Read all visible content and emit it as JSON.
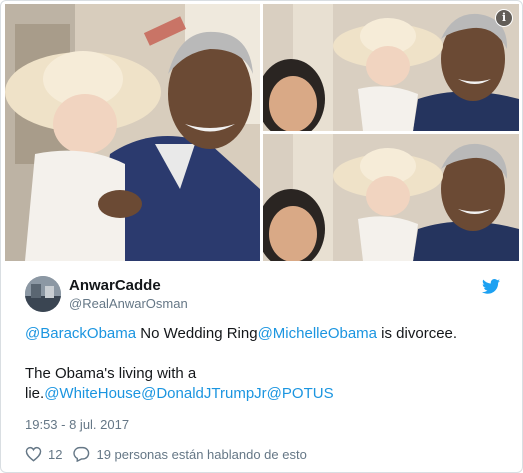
{
  "tweet": {
    "display_name": "AnwarCadde",
    "handle": "@RealAnwarOsman",
    "line1": {
      "mention1": "@BarackObama",
      "text1": " No Wedding Ring",
      "mention2": "@MichelleObama",
      "text2": " is divorcee."
    },
    "line2": "The Obama's living with a",
    "line3": {
      "text1": "lie.",
      "mention1": "@WhiteHouse",
      "mention2": "@DonaldJTrumpJr",
      "mention3": "@POTUS"
    },
    "timestamp": "19:53 - 8 jul. 2017",
    "likes": "12",
    "discussion": "19 personas están hablando de esto"
  },
  "icons": {
    "info": "info-icon",
    "bird": "twitter-bird-icon",
    "heart": "heart-icon",
    "reply": "speech-bubble-icon",
    "info_glyph": "i"
  },
  "colors": {
    "link": "#1b95e0",
    "secondary_text": "#657786",
    "brand": "#1da1f2"
  }
}
